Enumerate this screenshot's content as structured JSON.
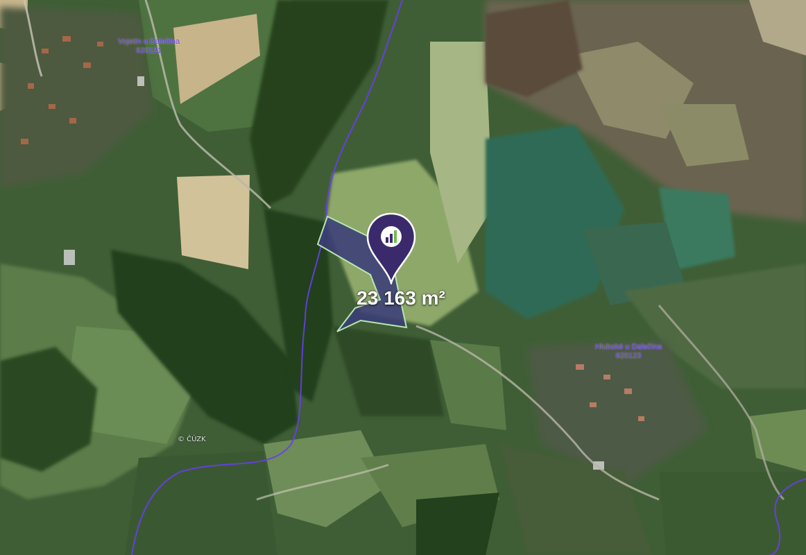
{
  "map": {
    "type": "satellite",
    "place_labels": [
      {
        "name": "Vojetín u Dalečína",
        "code": "620131"
      },
      {
        "name": "Hluboké u Dalečína",
        "code": "620123"
      }
    ],
    "parcel_area": "23 163 m²",
    "copyright": "© ČÚZK",
    "pin_icon": "chart-bars-icon",
    "colors": {
      "parcel_fill": "#3b3d78",
      "parcel_outline": "#b8e6b0",
      "pin": "#3b2a6b",
      "boundary_line": "#6a3df0"
    }
  }
}
